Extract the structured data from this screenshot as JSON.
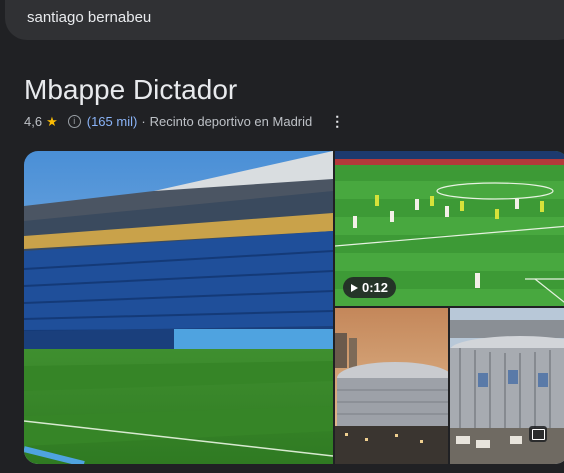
{
  "search": {
    "query": "santiago bernabeu"
  },
  "place": {
    "name": "Mbappe Dictador",
    "rating": "4,6",
    "reviews": "(165 mil)",
    "separator": "·",
    "category": "Recinto deportivo en Madrid"
  },
  "gallery": {
    "video_duration": "0:12"
  }
}
